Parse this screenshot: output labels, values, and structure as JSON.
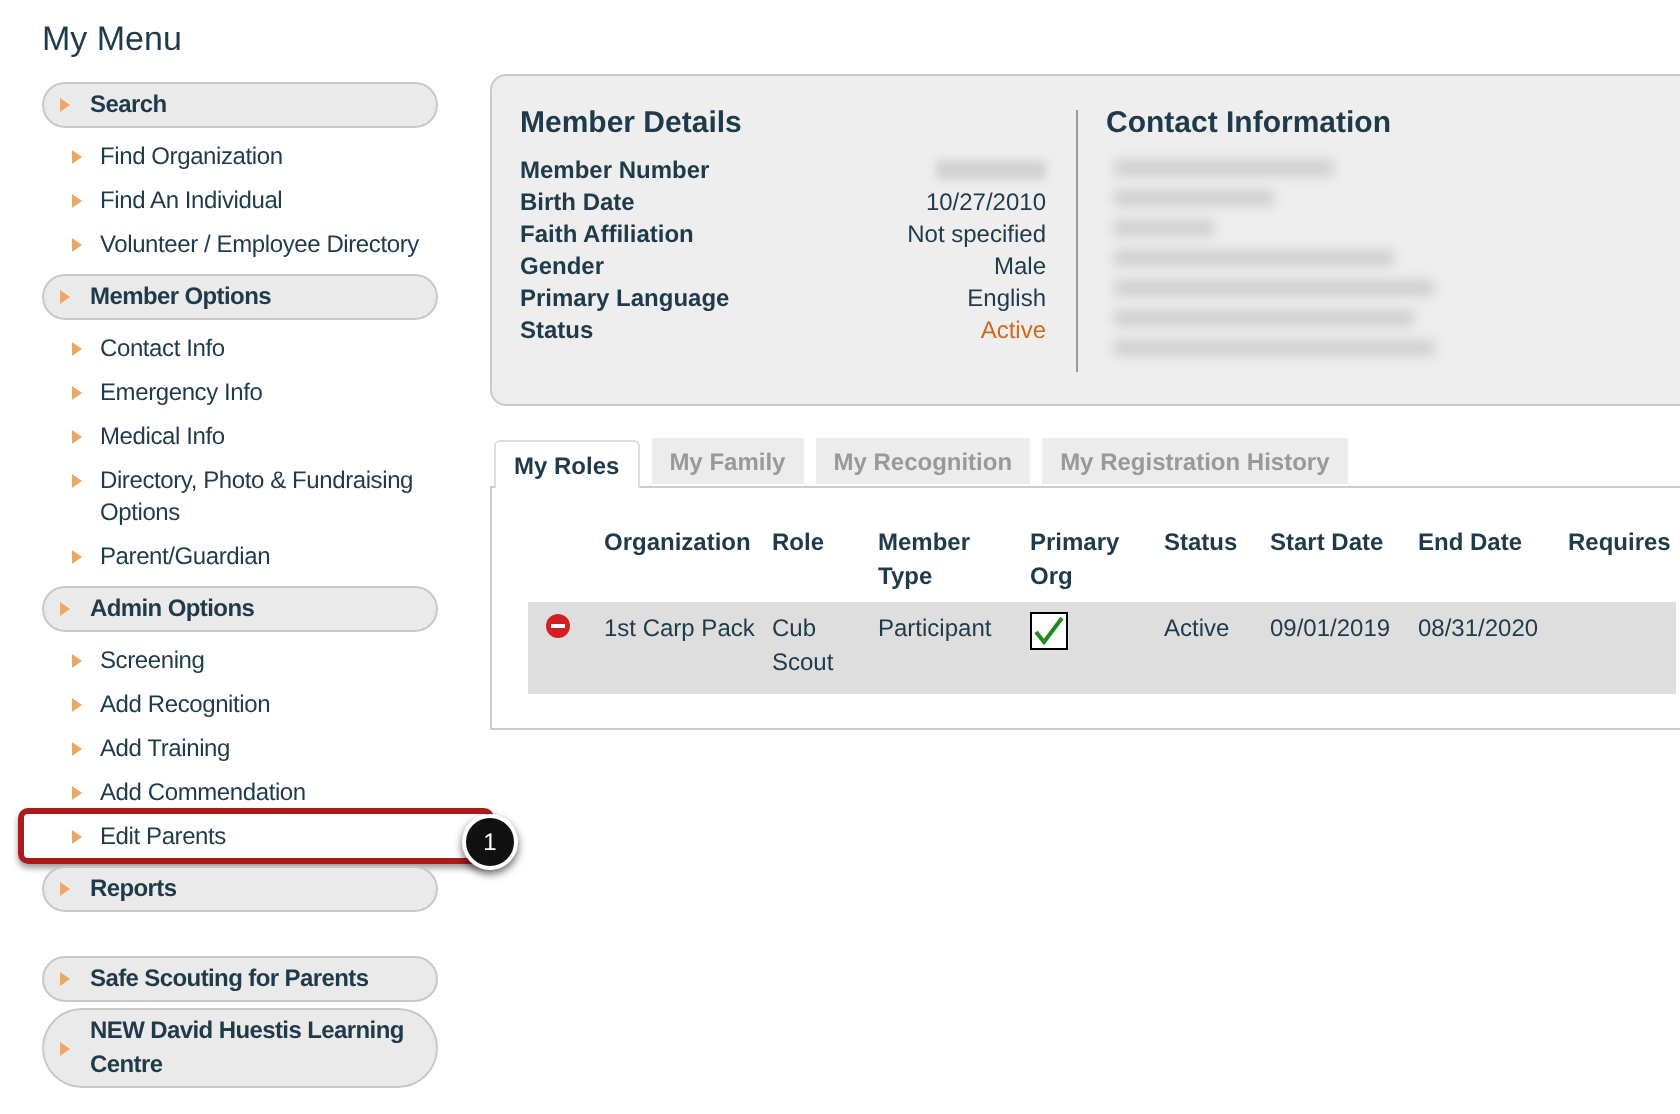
{
  "menu_title": "My Menu",
  "menu_groups": [
    [
      {
        "title": "Search",
        "items": [
          {
            "label": "Find Organization",
            "highlighted": false
          },
          {
            "label": "Find An Individual",
            "highlighted": false
          },
          {
            "label": "Volunteer / Employee Directory",
            "highlighted": false
          }
        ]
      },
      {
        "title": "Member Options",
        "items": [
          {
            "label": "Contact Info",
            "highlighted": false
          },
          {
            "label": "Emergency Info",
            "highlighted": false
          },
          {
            "label": "Medical Info",
            "highlighted": false
          },
          {
            "label": "Directory, Photo & Fundraising Options",
            "highlighted": false
          },
          {
            "label": "Parent/Guardian",
            "highlighted": false
          }
        ]
      },
      {
        "title": "Admin Options",
        "items": [
          {
            "label": "Screening",
            "highlighted": false
          },
          {
            "label": "Add Recognition",
            "highlighted": false
          },
          {
            "label": "Add Training",
            "highlighted": false
          },
          {
            "label": "Add Commendation",
            "highlighted": false
          },
          {
            "label": "Edit Parents",
            "highlighted": true
          }
        ]
      },
      {
        "title": "Reports"
      }
    ],
    [
      {
        "title": "Safe Scouting for Parents"
      },
      {
        "title": "NEW David Huestis Learning Centre"
      }
    ]
  ],
  "callout": {
    "number": "1"
  },
  "member_details": {
    "title": "Member Details",
    "fields": [
      {
        "label": "Member Number",
        "kind": "redacted"
      },
      {
        "label": "Birth Date",
        "value": "10/27/2010",
        "kind": "text"
      },
      {
        "label": "Faith Affiliation",
        "value": "Not specified",
        "kind": "text"
      },
      {
        "label": "Gender",
        "value": "Male",
        "kind": "text"
      },
      {
        "label": "Primary Language",
        "value": "English",
        "kind": "text"
      },
      {
        "label": "Status",
        "value": "Active",
        "kind": "status"
      }
    ]
  },
  "contact_information": {
    "title": "Contact Information"
  },
  "tabs": [
    {
      "label": "My Roles",
      "selected": true
    },
    {
      "label": "My Family",
      "selected": false
    },
    {
      "label": "My Recognition",
      "selected": false
    },
    {
      "label": "My Registration History",
      "selected": false
    }
  ],
  "roles_table": {
    "columns": [
      "Organization",
      "Role",
      "Member Type",
      "Primary Org",
      "Status",
      "Start Date",
      "End Date",
      "Requires"
    ],
    "rows": [
      {
        "organization": "1st Carp Pack",
        "role": "Cub Scout",
        "member_type": "Participant",
        "primary_org": true,
        "status": "Active",
        "start_date": "09/01/2019",
        "end_date": "08/31/2020"
      }
    ]
  }
}
